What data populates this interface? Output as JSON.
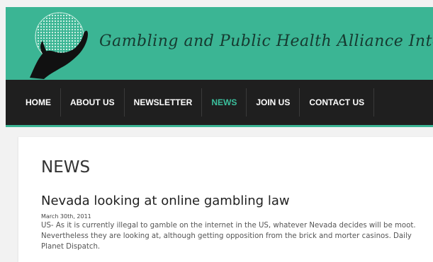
{
  "site": {
    "title": "Gambling and Public Health Alliance International",
    "logo_icon": "globe-hand-icon"
  },
  "nav": {
    "items": [
      {
        "label": "HOME"
      },
      {
        "label": "ABOUT US"
      },
      {
        "label": "NEWSLETTER"
      },
      {
        "label": "NEWS",
        "active": true
      },
      {
        "label": "JOIN US"
      },
      {
        "label": "CONTACT US"
      }
    ]
  },
  "page": {
    "title": "NEWS"
  },
  "post": {
    "title": "Nevada looking at online gambling law",
    "date": "March 30th, 2011",
    "body": "US- As it is currently illegal to gamble on the internet in the US, whatever Nevada decides will be moot. Nevertheless they are looking at, although getting opposition from the brick and morter casinos. Daily Planet Dispatch."
  },
  "colors": {
    "brand_green": "#3bb594",
    "nav_bg": "#1f1f1f",
    "nav_active": "#3bbf9c"
  }
}
